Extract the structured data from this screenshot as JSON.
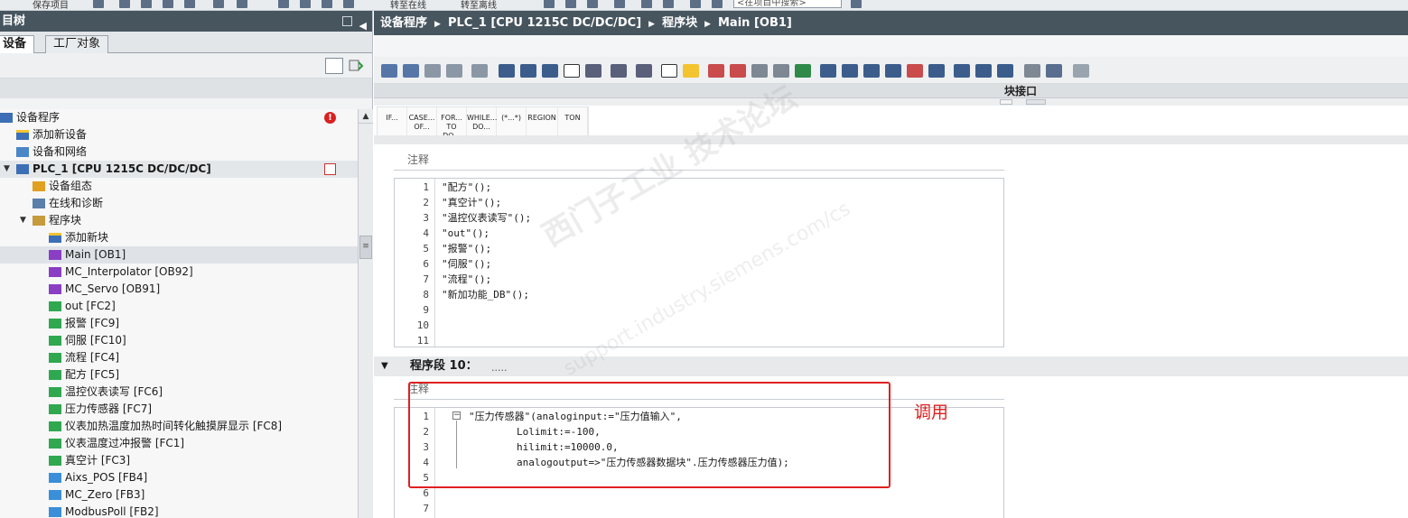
{
  "toolbar": {
    "save_label": "保存项目",
    "goto_online": "转至在线",
    "goto_offline": "转至离线",
    "search_placeholder": "<在项目中搜索>"
  },
  "left_panel": {
    "title": "目树",
    "tabs": [
      {
        "label": "设备"
      },
      {
        "label": "工厂对象"
      }
    ],
    "tree": [
      {
        "label": "设备程序",
        "icon": "device-icon",
        "indent": 0
      },
      {
        "label": "添加新设备",
        "icon": "add-device-icon",
        "indent": 1
      },
      {
        "label": "设备和网络",
        "icon": "network-icon",
        "indent": 1
      },
      {
        "label": "PLC_1 [CPU 1215C DC/DC/DC]",
        "icon": "plc-icon",
        "indent": 1
      },
      {
        "label": "设备组态",
        "icon": "device-config-icon",
        "indent": 2
      },
      {
        "label": "在线和诊断",
        "icon": "diagnostics-icon",
        "indent": 2
      },
      {
        "label": "程序块",
        "icon": "folder-icon",
        "indent": 2
      },
      {
        "label": "添加新块",
        "icon": "add-block-icon",
        "indent": 3
      },
      {
        "label": "Main [OB1]",
        "icon": "ob-icon",
        "indent": 3
      },
      {
        "label": "MC_Interpolator [OB92]",
        "icon": "ob-icon",
        "indent": 3
      },
      {
        "label": "MC_Servo [OB91]",
        "icon": "ob-icon",
        "indent": 3
      },
      {
        "label": "out [FC2]",
        "icon": "fc-icon",
        "indent": 3
      },
      {
        "label": "报警 [FC9]",
        "icon": "fc-icon",
        "indent": 3
      },
      {
        "label": "伺服 [FC10]",
        "icon": "fc-icon",
        "indent": 3
      },
      {
        "label": "流程 [FC4]",
        "icon": "fc-icon",
        "indent": 3
      },
      {
        "label": "配方 [FC5]",
        "icon": "fc-icon",
        "indent": 3
      },
      {
        "label": "温控仪表读写 [FC6]",
        "icon": "fc-icon",
        "indent": 3
      },
      {
        "label": "压力传感器 [FC7]",
        "icon": "fc-icon",
        "indent": 3
      },
      {
        "label": "仪表加热温度加热时间转化触摸屏显示 [FC8]",
        "icon": "fc-icon",
        "indent": 3
      },
      {
        "label": "仪表温度过冲报警 [FC1]",
        "icon": "fc-icon",
        "indent": 3
      },
      {
        "label": "真空计 [FC3]",
        "icon": "fc-icon",
        "indent": 3
      },
      {
        "label": "Aixs_POS [FB4]",
        "icon": "fb-icon",
        "indent": 3
      },
      {
        "label": "MC_Zero [FB3]",
        "icon": "fb-icon",
        "indent": 3
      },
      {
        "label": "ModbusPoll [FB2]",
        "icon": "fb-icon",
        "indent": 3
      }
    ]
  },
  "editor": {
    "breadcrumb": [
      "设备程序",
      "PLC_1 [CPU 1215C DC/DC/DC]",
      "程序块",
      "Main [OB1]"
    ],
    "interface_label": "块接口",
    "instructions": [
      "IF...",
      "CASE... OF...",
      "FOR... TO DO...",
      "WHILE... DO...",
      "(*...*)",
      "REGION",
      "TON"
    ],
    "segment9": {
      "comment": "注释",
      "lines": [
        {
          "n": "1",
          "text": "\"配方\"();"
        },
        {
          "n": "2",
          "text": "\"真空计\"();"
        },
        {
          "n": "3",
          "text": "\"温控仪表读写\"();"
        },
        {
          "n": "4",
          "text": "\"out\"();"
        },
        {
          "n": "5",
          "text": "\"报警\"();"
        },
        {
          "n": "6",
          "text": "\"伺服\"();"
        },
        {
          "n": "7",
          "text": "\"流程\"();"
        },
        {
          "n": "8",
          "text": "\"新加功能_DB\"();"
        },
        {
          "n": "9",
          "text": ""
        },
        {
          "n": "10",
          "text": ""
        },
        {
          "n": "11",
          "text": ""
        }
      ]
    },
    "segment10": {
      "title": "程序段 10：",
      "dots": ".....",
      "comment": "注释",
      "lines": [
        {
          "n": "1",
          "text": "\"压力传感器\"(analoginput:=\"压力值输入\","
        },
        {
          "n": "2",
          "text": "        Lolimit:=-100,"
        },
        {
          "n": "3",
          "text": "        hilimit:=10000.0,"
        },
        {
          "n": "4",
          "text": "        analogoutput=>\"压力传感器数据块\".压力传感器压力值);"
        },
        {
          "n": "5",
          "text": ""
        },
        {
          "n": "6",
          "text": ""
        },
        {
          "n": "7",
          "text": ""
        }
      ]
    }
  },
  "annotation": {
    "label": "调用",
    "color": "#e02020"
  },
  "watermark": {
    "line1": "西门子工业 技术论坛",
    "line2": "support.industry.siemens.com/cs"
  },
  "colors": {
    "header_bg": "#47555f",
    "ob": "#8a3ec4",
    "fc": "#2fa84f",
    "fb": "#3a8fd8"
  }
}
